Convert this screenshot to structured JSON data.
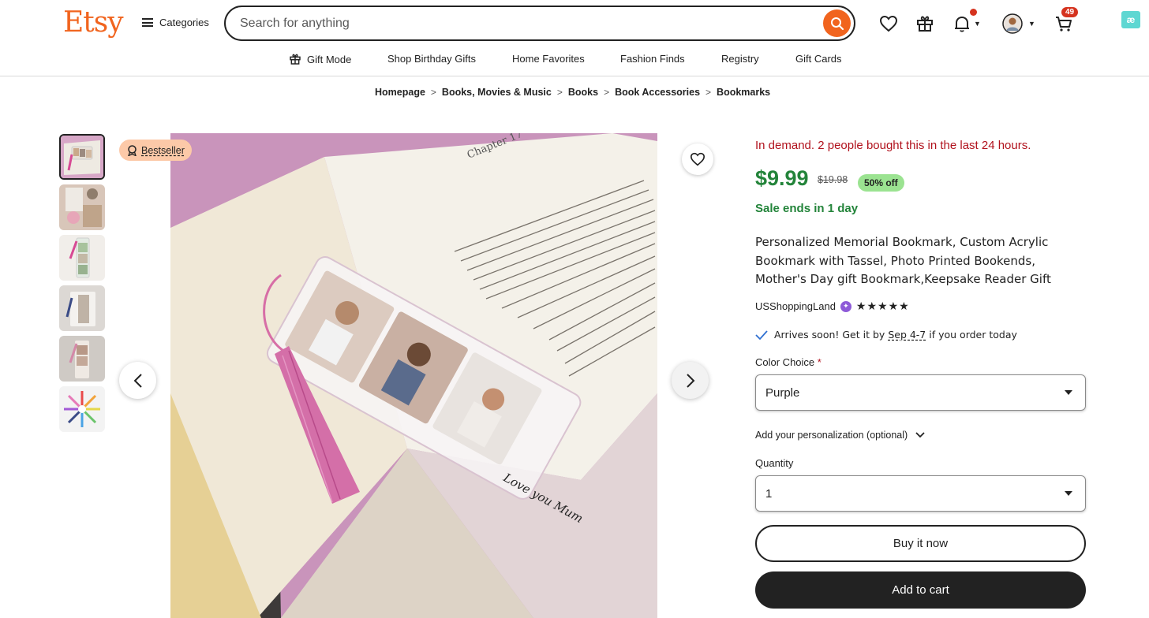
{
  "header": {
    "logo": "Etsy",
    "categories_label": "Categories",
    "search_placeholder": "Search for anything",
    "cart_count": "49",
    "brand_color": "#f1641e"
  },
  "subnav": [
    {
      "label": "Gift Mode",
      "icon": "gift-icon"
    },
    {
      "label": "Shop Birthday Gifts"
    },
    {
      "label": "Home Favorites"
    },
    {
      "label": "Fashion Finds"
    },
    {
      "label": "Registry"
    },
    {
      "label": "Gift Cards"
    }
  ],
  "breadcrumb": [
    "Homepage",
    "Books, Movies & Music",
    "Books",
    "Book Accessories",
    "Bookmarks"
  ],
  "gallery": {
    "badge": "Bestseller",
    "thumbnail_count": 6,
    "active_thumbnail": 1
  },
  "product": {
    "demand": "In demand. 2 people bought this in the last 24 hours.",
    "price": "$9.99",
    "original_price": "$19.98",
    "discount": "50% off",
    "sale_ends": "Sale ends in 1 day",
    "title": "Personalized Memorial Bookmark, Custom Acrylic Bookmark with Tassel, Photo Printed Bookends, Mother's Day gift Bookmark,Keepsake Reader Gift",
    "shop": "USShoppingLand",
    "rating": 5,
    "arrives_prefix": "Arrives soon! Get it by",
    "arrives_date": "Sep 4-7",
    "arrives_suffix": "if you order today",
    "price_color": "#23843a",
    "demand_color": "#b1121d"
  },
  "options": {
    "color_label": "Color Choice",
    "color_required": "*",
    "color_value": "Purple",
    "personalization_label": "Add your personalization (optional)",
    "quantity_label": "Quantity",
    "quantity_value": "1"
  },
  "actions": {
    "buy_now": "Buy it now",
    "add_to_cart": "Add to cart"
  },
  "image_text": {
    "chapter": "Chapter 17",
    "inscription": "Love you Mum"
  }
}
